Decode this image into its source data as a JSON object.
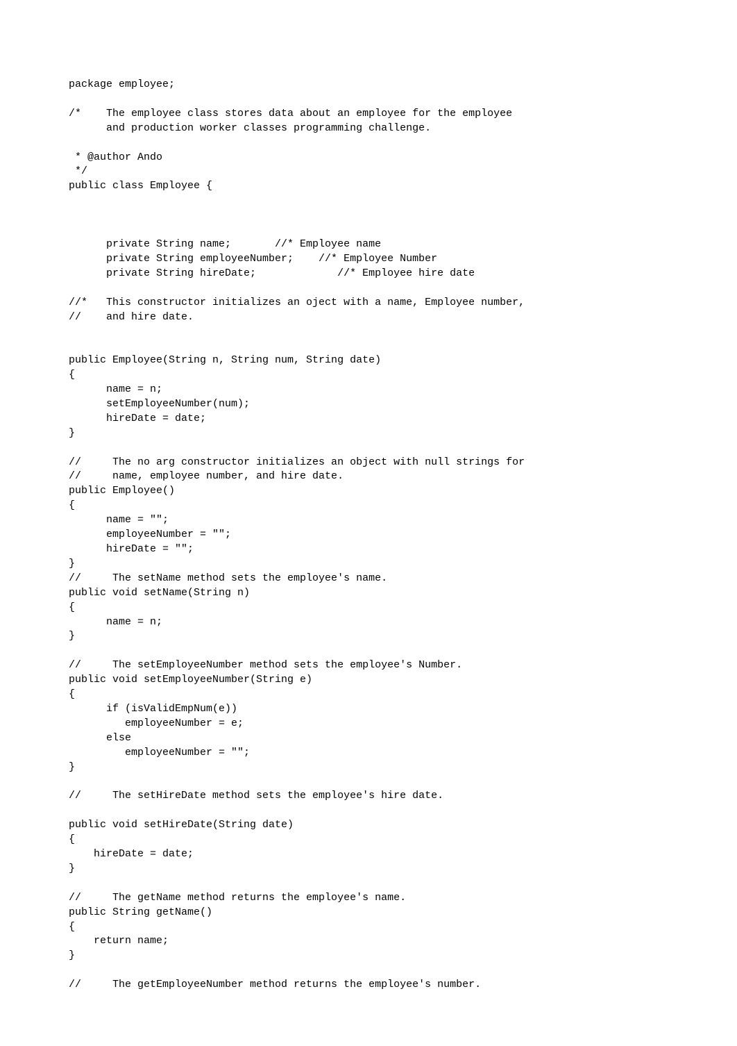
{
  "code": {
    "lines": [
      "package employee;",
      "",
      "/*    The employee class stores data about an employee for the employee",
      "      and production worker classes programming challenge.",
      "",
      " * @author Ando",
      " */",
      "public class Employee {",
      "",
      "",
      "",
      "      private String name;       //* Employee name",
      "      private String employeeNumber;    //* Employee Number",
      "      private String hireDate;             //* Employee hire date",
      "",
      "//*   This constructor initializes an oject with a name, Employee number,",
      "//    and hire date.",
      "",
      "",
      "public Employee(String n, String num, String date)",
      "{",
      "      name = n;",
      "      setEmployeeNumber(num);",
      "      hireDate = date;",
      "}",
      "",
      "//     The no arg constructor initializes an object with null strings for",
      "//     name, employee number, and hire date.",
      "public Employee()",
      "{",
      "      name = \"\";",
      "      employeeNumber = \"\";",
      "      hireDate = \"\";",
      "}",
      "//     The setName method sets the employee's name.",
      "public void setName(String n)",
      "{",
      "      name = n;",
      "}",
      "",
      "//     The setEmployeeNumber method sets the employee's Number.",
      "public void setEmployeeNumber(String e)",
      "{",
      "      if (isValidEmpNum(e))",
      "         employeeNumber = e;",
      "      else",
      "         employeeNumber = \"\";",
      "}",
      "",
      "//     The setHireDate method sets the employee's hire date.",
      "",
      "public void setHireDate(String date)",
      "{",
      "    hireDate = date;",
      "}",
      "",
      "//     The getName method returns the employee's name.",
      "public String getName()",
      "{",
      "    return name;",
      "}",
      "",
      "//     The getEmployeeNumber method returns the employee's number."
    ]
  }
}
